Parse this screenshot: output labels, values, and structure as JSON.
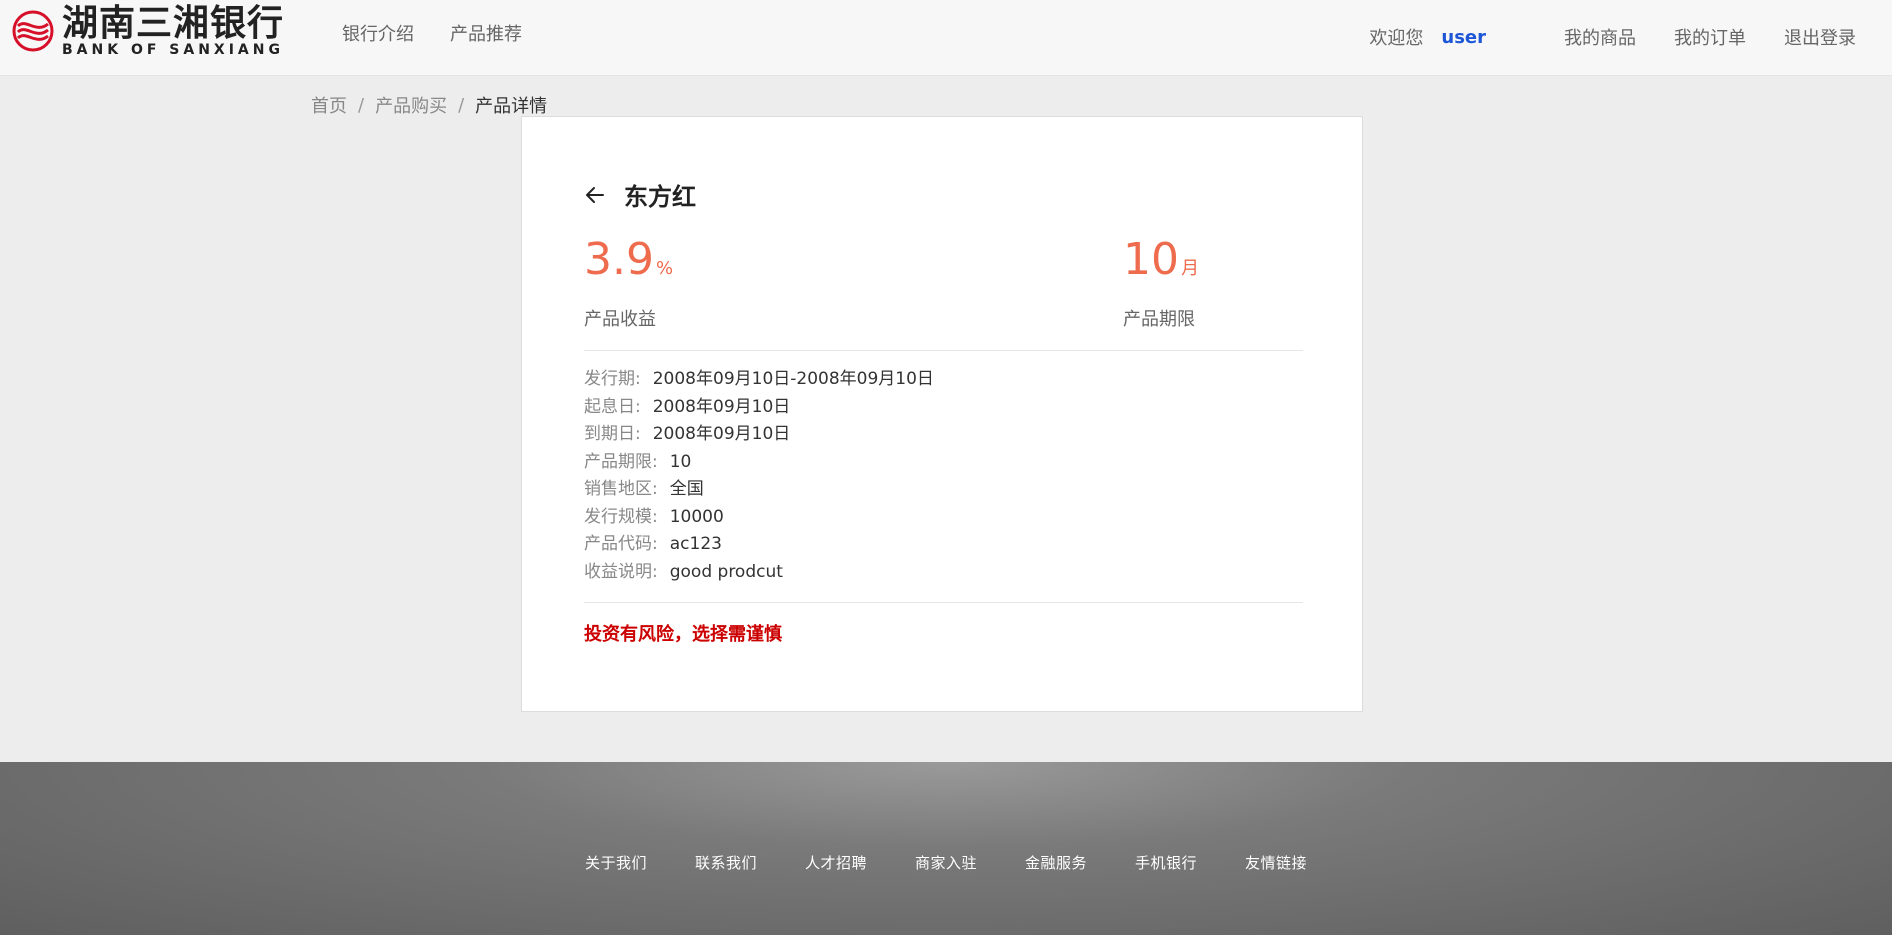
{
  "header": {
    "logo_cn": "湖南三湘银行",
    "logo_en": "BANK OF SANXIANG",
    "nav_left": [
      "银行介绍",
      "产品推荐"
    ],
    "welcome": "欢迎您",
    "username": "user",
    "nav_right": [
      "我的商品",
      "我的订单",
      "退出登录"
    ]
  },
  "breadcrumb": {
    "items": [
      "首页",
      "产品购买",
      "产品详情"
    ],
    "separator": "/"
  },
  "product": {
    "name": "东方红",
    "yield_value": "3.9",
    "yield_unit": "%",
    "yield_label": "产品收益",
    "term_value": "10",
    "term_unit": "月",
    "term_label": "产品期限",
    "details": [
      {
        "key": "发行期:",
        "value": "2008年09月10日-2008年09月10日"
      },
      {
        "key": "起息日:",
        "value": "2008年09月10日"
      },
      {
        "key": "到期日:",
        "value": "2008年09月10日"
      },
      {
        "key": "产品期限:",
        "value": "10"
      },
      {
        "key": "销售地区:",
        "value": "全国"
      },
      {
        "key": "发行规模:",
        "value": "10000"
      },
      {
        "key": "产品代码:",
        "value": "ac123"
      },
      {
        "key": "收益说明:",
        "value": "good prodcut"
      }
    ],
    "risk_notice": "投资有风险，选择需谨慎"
  },
  "footer": {
    "links": [
      "关于我们",
      "联系我们",
      "人才招聘",
      "商家入驻",
      "金融服务",
      "手机银行",
      "友情链接"
    ]
  },
  "colors": {
    "accent_orange": "#ee6b4d",
    "risk_red": "#cc0000",
    "user_blue": "#1d57d8",
    "logo_red": "#d7102a"
  },
  "icons": {
    "logo": "bank-logo-icon",
    "back": "arrow-left-icon"
  }
}
